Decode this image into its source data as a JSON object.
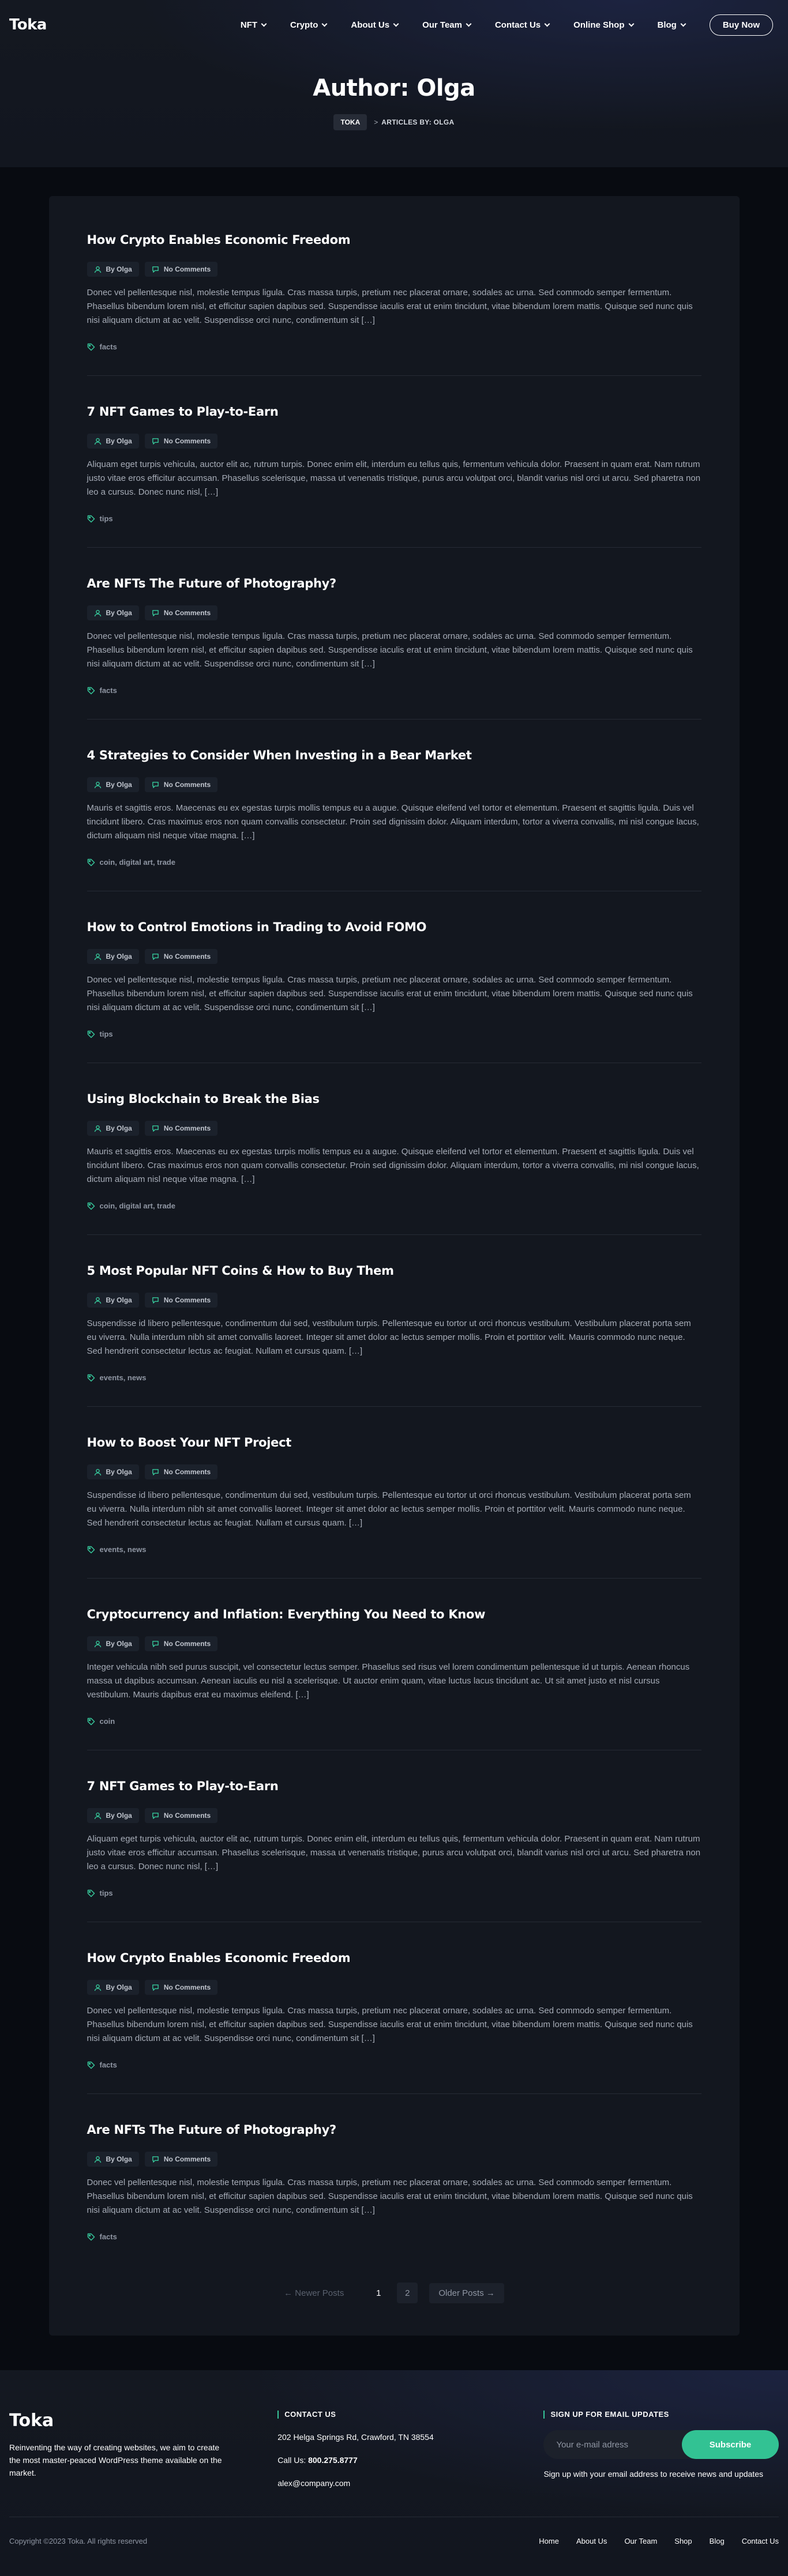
{
  "header": {
    "logo": "Toka",
    "menu": [
      {
        "label": "NFT",
        "has_dropdown": true
      },
      {
        "label": "Crypto",
        "has_dropdown": true
      },
      {
        "label": "About Us",
        "has_dropdown": true
      },
      {
        "label": "Our Team",
        "has_dropdown": true
      },
      {
        "label": "Contact Us",
        "has_dropdown": true
      },
      {
        "label": "Online Shop",
        "has_dropdown": true
      },
      {
        "label": "Blog",
        "has_dropdown": true
      }
    ],
    "buy_now": "Buy Now"
  },
  "hero": {
    "title": "Author: Olga",
    "breadcrumb_home": "TOKA",
    "breadcrumb_sep": ">",
    "breadcrumb_current": "ARTICLES BY: OLGA"
  },
  "posts": [
    {
      "title": "How Crypto Enables Economic Freedom",
      "author": "By Olga",
      "comments": "No Comments",
      "excerpt": "Donec vel pellentesque nisl, molestie tempus ligula. Cras massa turpis, pretium nec placerat ornare, sodales ac urna. Sed commodo semper fermentum. Phasellus bibendum lorem nisl, et efficitur sapien dapibus sed. Suspendisse iaculis erat ut enim tincidunt, vitae bibendum lorem mattis. Quisque sed nunc quis nisi aliquam dictum at ac velit. Suspendisse orci nunc, condimentum sit […]",
      "tags": "facts"
    },
    {
      "title": "7 NFT Games to Play-to-Earn",
      "author": "By Olga",
      "comments": "No Comments",
      "excerpt": "Aliquam eget turpis vehicula, auctor elit ac, rutrum turpis. Donec enim elit, interdum eu tellus quis, fermentum vehicula dolor. Praesent in quam erat. Nam rutrum justo vitae eros efficitur accumsan. Phasellus scelerisque, massa ut venenatis tristique, purus arcu volutpat orci, blandit varius nisl orci ut arcu. Sed pharetra non leo a cursus. Donec nunc nisl, […]",
      "tags": "tips"
    },
    {
      "title": "Are NFTs The Future of Photography?",
      "author": "By Olga",
      "comments": "No Comments",
      "excerpt": "Donec vel pellentesque nisl, molestie tempus ligula. Cras massa turpis, pretium nec placerat ornare, sodales ac urna. Sed commodo semper fermentum. Phasellus bibendum lorem nisl, et efficitur sapien dapibus sed. Suspendisse iaculis erat ut enim tincidunt, vitae bibendum lorem mattis. Quisque sed nunc quis nisi aliquam dictum at ac velit. Suspendisse orci nunc, condimentum sit […]",
      "tags": "facts"
    },
    {
      "title": "4 Strategies to Consider When Investing in a Bear Market",
      "author": "By Olga",
      "comments": "No Comments",
      "excerpt": "Mauris et sagittis eros. Maecenas eu ex egestas turpis mollis tempus eu a augue. Quisque eleifend vel tortor et elementum. Praesent et sagittis ligula. Duis vel tincidunt libero. Cras maximus eros non quam convallis consectetur. Proin sed dignissim dolor. Aliquam interdum, tortor a viverra convallis, mi nisl congue lacus, dictum aliquam nisl neque vitae magna. […]",
      "tags": "coin, digital art, trade"
    },
    {
      "title": "How to Control Emotions in Trading to Avoid FOMO",
      "author": "By Olga",
      "comments": "No Comments",
      "excerpt": "Donec vel pellentesque nisl, molestie tempus ligula. Cras massa turpis, pretium nec placerat ornare, sodales ac urna. Sed commodo semper fermentum. Phasellus bibendum lorem nisl, et efficitur sapien dapibus sed. Suspendisse iaculis erat ut enim tincidunt, vitae bibendum lorem mattis. Quisque sed nunc quis nisi aliquam dictum at ac velit. Suspendisse orci nunc, condimentum sit […]",
      "tags": "tips"
    },
    {
      "title": "Using Blockchain to Break the Bias",
      "author": "By Olga",
      "comments": "No Comments",
      "excerpt": "Mauris et sagittis eros. Maecenas eu ex egestas turpis mollis tempus eu a augue. Quisque eleifend vel tortor et elementum. Praesent et sagittis ligula. Duis vel tincidunt libero. Cras maximus eros non quam convallis consectetur. Proin sed dignissim dolor. Aliquam interdum, tortor a viverra convallis, mi nisl congue lacus, dictum aliquam nisl neque vitae magna. […]",
      "tags": "coin, digital art, trade"
    },
    {
      "title": "5 Most Popular NFT Coins & How to Buy Them",
      "author": "By Olga",
      "comments": "No Comments",
      "excerpt": "Suspendisse id libero pellentesque, condimentum dui sed, vestibulum turpis. Pellentesque eu tortor ut orci rhoncus vestibulum. Vestibulum placerat porta sem eu viverra. Nulla interdum nibh sit amet convallis laoreet. Integer sit amet dolor ac lectus semper mollis. Proin et porttitor velit. Mauris commodo nunc neque. Sed hendrerit consectetur lectus ac feugiat. Nullam et cursus quam. […]",
      "tags": "events, news"
    },
    {
      "title": "How to Boost Your NFT Project",
      "author": "By Olga",
      "comments": "No Comments",
      "excerpt": "Suspendisse id libero pellentesque, condimentum dui sed, vestibulum turpis. Pellentesque eu tortor ut orci rhoncus vestibulum. Vestibulum placerat porta sem eu viverra. Nulla interdum nibh sit amet convallis laoreet. Integer sit amet dolor ac lectus semper mollis. Proin et porttitor velit. Mauris commodo nunc neque. Sed hendrerit consectetur lectus ac feugiat. Nullam et cursus quam. […]",
      "tags": "events, news"
    },
    {
      "title": "Cryptocurrency and Inflation: Everything You Need to Know",
      "author": "By Olga",
      "comments": "No Comments",
      "excerpt": "Integer vehicula nibh sed purus suscipit, vel consectetur lectus semper. Phasellus sed risus vel lorem condimentum pellentesque id ut turpis. Aenean rhoncus massa ut dapibus accumsan. Aenean iaculis eu nisl a scelerisque. Ut auctor enim quam, vitae luctus lacus tincidunt ac. Ut sit amet justo et nisl cursus vestibulum. Mauris dapibus erat eu maximus eleifend. […]",
      "tags": "coin"
    },
    {
      "title": "7 NFT Games to Play-to-Earn",
      "author": "By Olga",
      "comments": "No Comments",
      "excerpt": "Aliquam eget turpis vehicula, auctor elit ac, rutrum turpis. Donec enim elit, interdum eu tellus quis, fermentum vehicula dolor. Praesent in quam erat. Nam rutrum justo vitae eros efficitur accumsan. Phasellus scelerisque, massa ut venenatis tristique, purus arcu volutpat orci, blandit varius nisl orci ut arcu. Sed pharetra non leo a cursus. Donec nunc nisl, […]",
      "tags": "tips"
    },
    {
      "title": "How Crypto Enables Economic Freedom",
      "author": "By Olga",
      "comments": "No Comments",
      "excerpt": "Donec vel pellentesque nisl, molestie tempus ligula. Cras massa turpis, pretium nec placerat ornare, sodales ac urna. Sed commodo semper fermentum. Phasellus bibendum lorem nisl, et efficitur sapien dapibus sed. Suspendisse iaculis erat ut enim tincidunt, vitae bibendum lorem mattis. Quisque sed nunc quis nisi aliquam dictum at ac velit. Suspendisse orci nunc, condimentum sit […]",
      "tags": "facts"
    },
    {
      "title": "Are NFTs The Future of Photography?",
      "author": "By Olga",
      "comments": "No Comments",
      "excerpt": "Donec vel pellentesque nisl, molestie tempus ligula. Cras massa turpis, pretium nec placerat ornare, sodales ac urna. Sed commodo semper fermentum. Phasellus bibendum lorem nisl, et efficitur sapien dapibus sed. Suspendisse iaculis erat ut enim tincidunt, vitae bibendum lorem mattis. Quisque sed nunc quis nisi aliquam dictum at ac velit. Suspendisse orci nunc, condimentum sit […]",
      "tags": "facts"
    }
  ],
  "pagination": {
    "prev": "← Newer Posts",
    "pages": [
      "1",
      "2"
    ],
    "current": "1",
    "next": "Older Posts →"
  },
  "footer": {
    "logo": "Toka",
    "description": "Reinventing the way of creating websites, we aim to create the most master-peaced WordPress theme available on the market.",
    "contact_heading": "CONTACT US",
    "address": "202 Helga Springs Rd, Crawford, TN 38554",
    "call_label": "Call Us: ",
    "phone": "800.275.8777",
    "email": "alex@company.com",
    "signup_heading": "SIGN UP FOR EMAIL UPDATES",
    "email_placeholder": "Your e-mail adress",
    "subscribe": "Subscribe",
    "signup_note": "Sign up with your email address to receive news and updates",
    "copyright": "Copyright ©2023 Toka. All rights reserved",
    "links": [
      "Home",
      "About Us",
      "Our Team",
      "Shop",
      "Blog",
      "Contact Us"
    ]
  },
  "colors": {
    "accent": "#32c293",
    "background": "#080b11",
    "card": "#13171f"
  },
  "icons": {
    "author": "user-icon",
    "comments": "comment-icon",
    "tags": "tag-icon"
  }
}
